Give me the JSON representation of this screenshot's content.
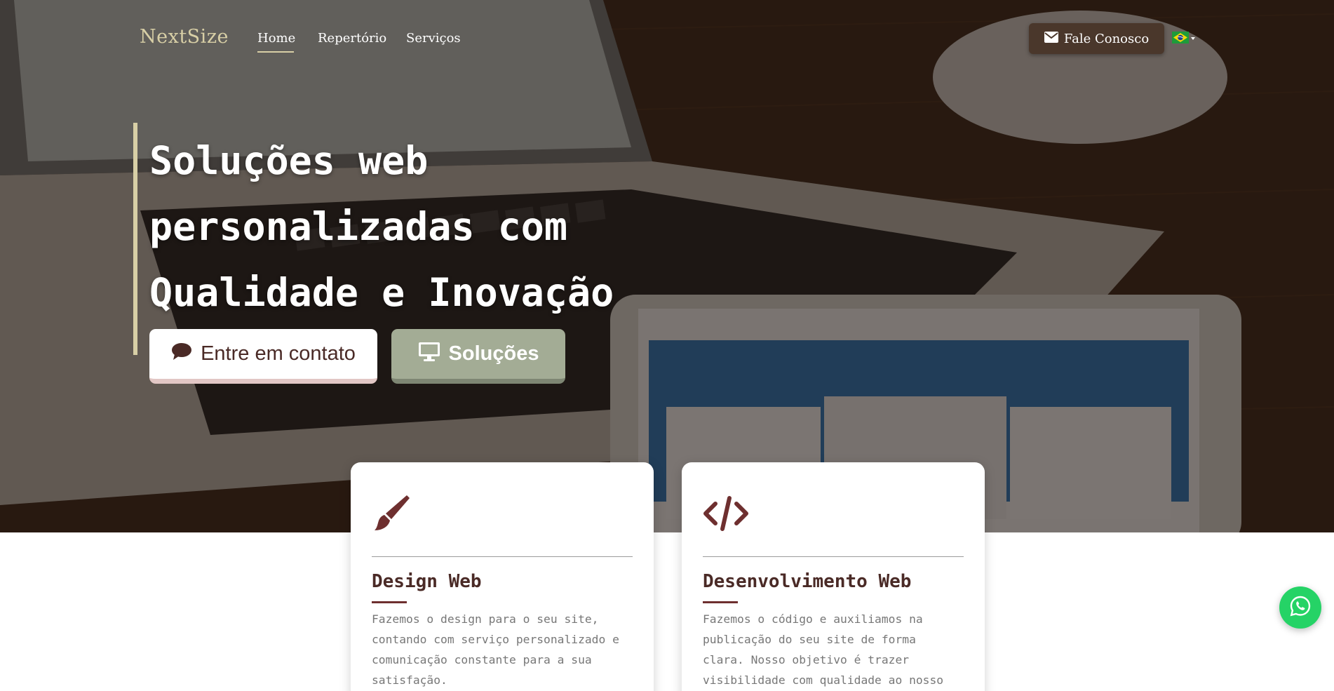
{
  "brand": {
    "name": "NextSize"
  },
  "nav": {
    "items": [
      {
        "label": "Home",
        "active": true
      },
      {
        "label": "Repertório",
        "active": false
      },
      {
        "label": "Serviços",
        "active": false
      }
    ],
    "cta_label": "Fale Conosco",
    "cta_icon": "envelope-icon",
    "language_flag": "brazil-flag-icon"
  },
  "hero": {
    "headline_lines": [
      "Soluções web",
      "personalizadas com",
      "Qualidade e Inovação"
    ],
    "buttons": {
      "contact": {
        "label": "Entre em contato",
        "icon": "chat-bubble-icon"
      },
      "solutions": {
        "label": "Soluções",
        "icon": "monitor-icon"
      }
    }
  },
  "services": [
    {
      "icon": "paintbrush-icon",
      "title": "Design Web",
      "text": "Fazemos o design para o seu site, contando com serviço personalizado e comunicação constante para a sua satisfação."
    },
    {
      "icon": "code-icon",
      "title": "Desenvolvimento Web",
      "text": "Fazemos o código e auxiliamos na publicação do seu site de forma clara. Nosso objetivo é trazer visibilidade com qualidade ao nosso cliente."
    }
  ],
  "floating": {
    "icon": "whatsapp-icon"
  },
  "colors": {
    "accent": "#d8cfa6",
    "brand_dark": "#4a2a26",
    "button_brown": "#4a372b",
    "button_sage": "#a3ac95",
    "whatsapp_green": "#25d366"
  }
}
